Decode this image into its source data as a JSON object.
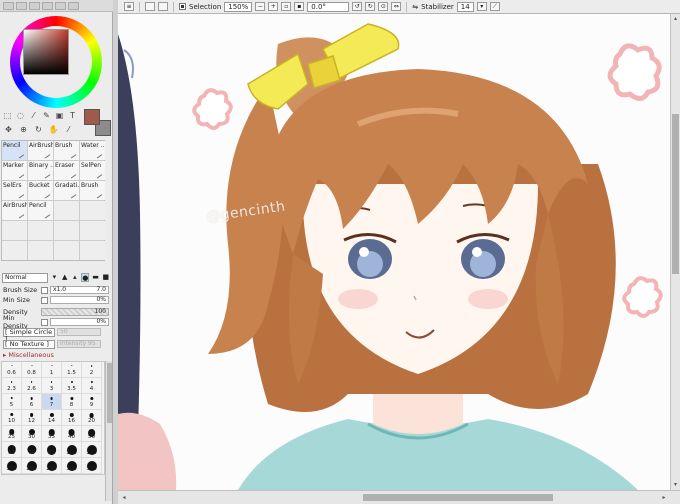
{
  "toolbar": {
    "selection_label": "Selection",
    "zoom": "150%",
    "rotation": "0.0°",
    "stabilizer_label": "Stabilizer",
    "stabilizer_value": "14"
  },
  "tools": {
    "brushes": [
      "Pencil",
      "AirBrush",
      "Brush",
      "Water ...",
      "Marker",
      "Binary ...",
      "Eraser",
      "SelPen",
      "SelErs",
      "Bucket",
      "Gradati...",
      "Brush",
      "AirBrush",
      "Pencil"
    ],
    "selected_brush_index": 0
  },
  "brush_settings": {
    "blend_mode": "Normal",
    "brush_size_label": "Brush Size",
    "brush_size_mult": "x1.0",
    "brush_size_value": "7.0",
    "min_size_label": "Min Size",
    "min_size_value": "0%",
    "density_label": "Density",
    "density_value": "100",
    "min_density_label": "Min Density",
    "min_density_value": "0%",
    "shape_select": "[ Simple Circle ]",
    "shape_bar_value": "50",
    "texture_select": "[ No Texture ]",
    "texture_bar_label": "Intensity",
    "texture_bar_value": "95",
    "misc_label": "Miscellaneous"
  },
  "size_presets": [
    "0.6",
    "0.8",
    "1",
    "1.5",
    "2",
    "2.3",
    "2.6",
    "3",
    "3.5",
    "4",
    "5",
    "6",
    "7",
    "8",
    "9",
    "10",
    "12",
    "14",
    "16",
    "20",
    "25",
    "30",
    "35",
    "40",
    "50",
    "60",
    "70",
    "80",
    "100",
    "120",
    "150",
    "200",
    "250",
    "300",
    "350"
  ],
  "selected_size": "7",
  "canvas": {
    "watermark": "@gencinth"
  },
  "colors": {
    "primary_swatch": "#a05a4b",
    "secondary_swatch": "#8c8c8c",
    "hair": "#c8824e",
    "bow": "#f4ea55",
    "skin": "#fff6ef",
    "shirt": "#a7d8d8",
    "flowers": "#f2b4b4"
  }
}
